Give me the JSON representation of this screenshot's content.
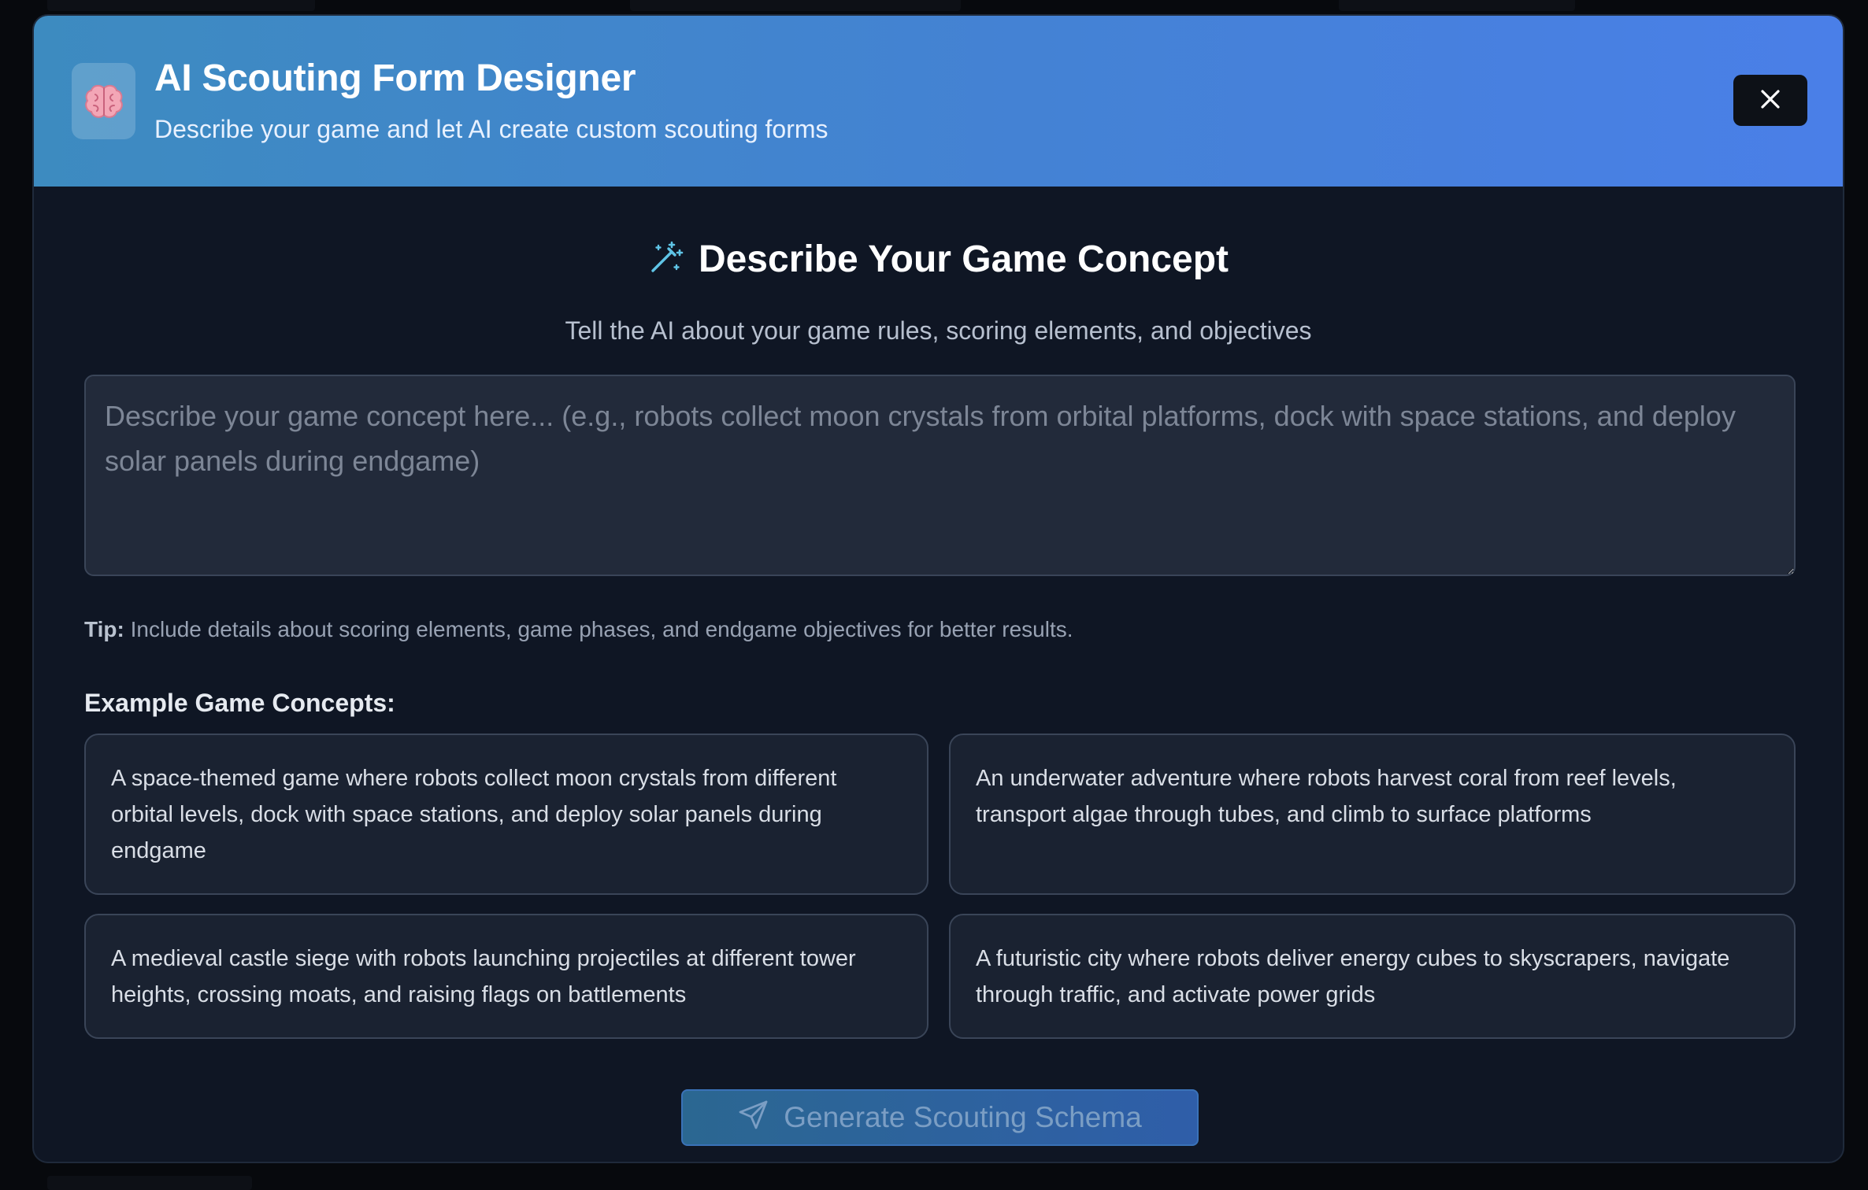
{
  "header": {
    "title": "AI Scouting Form Designer",
    "subtitle": "Describe your game and let AI create custom scouting forms",
    "logo_icon": "brain-icon",
    "close_icon": "close-icon"
  },
  "concept": {
    "heading": "Describe Your Game Concept",
    "heading_icon": "magic-wand-icon",
    "subheading": "Tell the AI about your game rules, scoring elements, and objectives",
    "input_value": "",
    "input_placeholder": "Describe your game concept here... (e.g., robots collect moon crystals from orbital platforms, dock with space stations, and deploy solar panels during endgame)",
    "tip_label": "Tip:",
    "tip_text": " Include details about scoring elements, game phases, and endgame objectives for better results."
  },
  "examples": {
    "label": "Example Game Concepts:",
    "items": [
      "A space-themed game where robots collect moon crystals from different orbital levels, dock with space stations, and deploy solar panels during endgame",
      "An underwater adventure where robots harvest coral from reef levels, transport algae through tubes, and climb to surface platforms",
      "A medieval castle siege with robots launching projectiles at different tower heights, crossing moats, and raising flags on battlements",
      "A futuristic city where robots deliver energy cubes to skyscrapers, navigate through traffic, and activate power grids"
    ]
  },
  "generate": {
    "label": "Generate Scouting Schema",
    "icon": "send-icon",
    "disabled": true
  },
  "colors": {
    "header_gradient_start": "#3d8bc0",
    "header_gradient_end": "#4a7fe8",
    "modal_bg": "#0f1624",
    "input_bg": "#222a3a",
    "card_bg": "#1a2231",
    "accent": "#4a7fe8"
  }
}
